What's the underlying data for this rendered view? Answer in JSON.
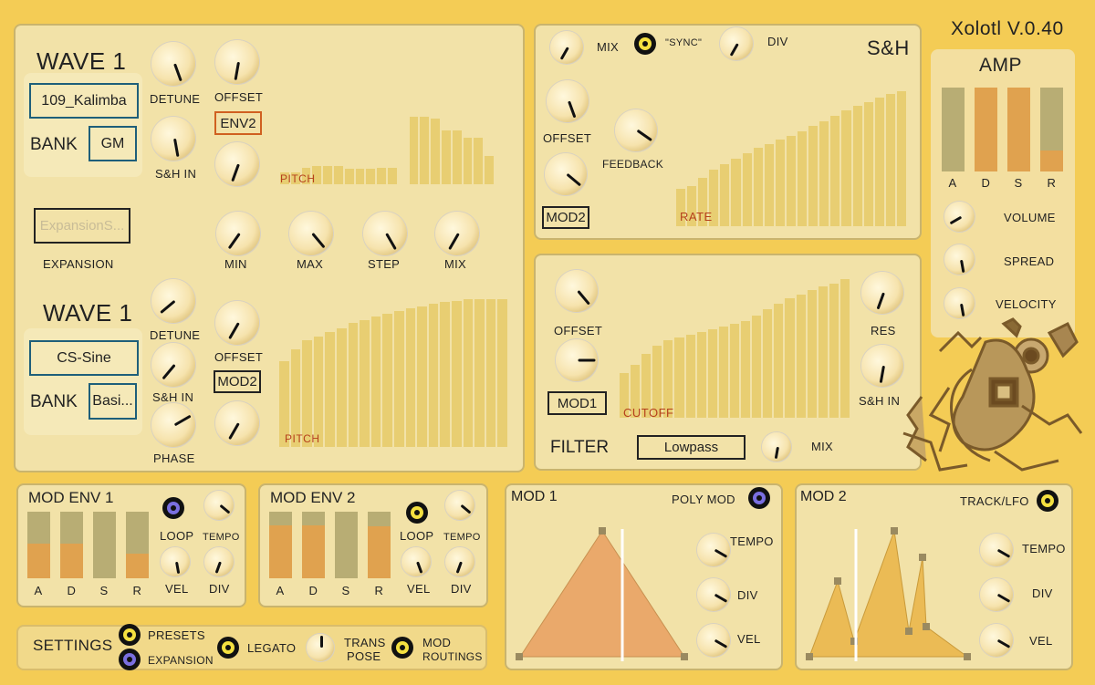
{
  "title": "Xolotl V.0.40",
  "colors": {
    "background": "#f4cc55",
    "panel": "#f2e2a8",
    "bars": "#e8ce72",
    "slider_track": "#b8ad74",
    "slider_fill": "#e0a24f",
    "accent_red": "#b5401d",
    "toggle_on": "#f4e040",
    "toggle_purple": "#7a6fe0"
  },
  "wave1a": {
    "title": "WAVE 1",
    "preset": "109_Kalimba",
    "bank_label": "BANK",
    "bank": "GM",
    "detune": "DETUNE",
    "offset": "OFFSET",
    "env": "ENV2",
    "sh_in": "S&H IN",
    "pitch": "PITCH",
    "expansion_value": "ExpansionS...",
    "expansion_label": "EXPANSION",
    "min": "MIN",
    "max": "MAX",
    "step": "STEP",
    "mix": "MIX"
  },
  "wave1b": {
    "title": "WAVE 1",
    "preset": "CS-Sine",
    "bank_label": "BANK",
    "bank": "Basi...",
    "detune": "DETUNE",
    "offset": "OFFSET",
    "mod": "MOD2",
    "sh_in": "S&H IN",
    "phase": "PHASE",
    "pitch": "PITCH"
  },
  "sh": {
    "title": "S&H",
    "mix": "MIX",
    "sync": "\"SYNC\"",
    "div": "DIV",
    "offset": "OFFSET",
    "feedback": "FEEDBACK",
    "mod": "MOD2",
    "rate": "RATE"
  },
  "filter": {
    "title": "FILTER",
    "offset": "OFFSET",
    "mod": "MOD1",
    "cutoff": "CUTOFF",
    "res": "RES",
    "sh_in": "S&H IN",
    "type": "Lowpass",
    "mix": "MIX"
  },
  "amp": {
    "title": "AMP",
    "adsr": [
      "A",
      "D",
      "S",
      "R"
    ],
    "levels": [
      0,
      1,
      1,
      0.25
    ],
    "volume": "VOLUME",
    "spread": "SPREAD",
    "velocity": "VELOCITY"
  },
  "modenv1": {
    "title": "MOD ENV 1",
    "loop": "LOOP",
    "tempo": "TEMPO",
    "vel": "VEL",
    "div": "DIV",
    "adsr": [
      "A",
      "D",
      "S",
      "R"
    ],
    "levels": [
      0.52,
      0.52,
      0,
      0.37
    ]
  },
  "modenv2": {
    "title": "MOD ENV 2",
    "loop": "LOOP",
    "tempo": "TEMPO",
    "vel": "VEL",
    "div": "DIV",
    "adsr": [
      "A",
      "D",
      "S",
      "R"
    ],
    "levels": [
      0.8,
      0.8,
      0,
      0.78
    ]
  },
  "mod1": {
    "title": "MOD 1",
    "poly": "POLY MOD",
    "tempo": "TEMPO",
    "div": "DIV",
    "vel": "VEL"
  },
  "mod2": {
    "title": "MOD 2",
    "track": "TRACK/LFO",
    "tempo": "TEMPO",
    "div": "DIV",
    "vel": "VEL"
  },
  "settings": {
    "title": "SETTINGS",
    "presets": "PRESETS",
    "expansion": "EXPANSION",
    "legato": "LEGATO",
    "trans": "TRANS",
    "pose": "POSE",
    "mod": "MOD",
    "routings": "ROUTINGS"
  },
  "sequences": {
    "wave1a_pitch": [
      0.14,
      0.14,
      0.2,
      0.22,
      0.22,
      0.22,
      0.18,
      0.18,
      0.18,
      0.2,
      0.2,
      0.0,
      0.8,
      0.8,
      0.78,
      0.64,
      0.64,
      0.55,
      0.55,
      0.34
    ],
    "wave1b_pitch": [
      0.58,
      0.66,
      0.72,
      0.75,
      0.78,
      0.8,
      0.84,
      0.86,
      0.88,
      0.9,
      0.92,
      0.94,
      0.95,
      0.97,
      0.98,
      0.99,
      1,
      1,
      1,
      1
    ],
    "sh_rate": [
      0.28,
      0.3,
      0.36,
      0.42,
      0.46,
      0.5,
      0.54,
      0.58,
      0.61,
      0.64,
      0.67,
      0.7,
      0.74,
      0.78,
      0.82,
      0.86,
      0.89,
      0.92,
      0.95,
      0.98,
      1
    ],
    "filter_cutoff": [
      0.32,
      0.38,
      0.46,
      0.52,
      0.56,
      0.58,
      0.6,
      0.62,
      0.64,
      0.66,
      0.68,
      0.7,
      0.74,
      0.78,
      0.82,
      0.86,
      0.89,
      0.92,
      0.95,
      0.97,
      1
    ]
  }
}
